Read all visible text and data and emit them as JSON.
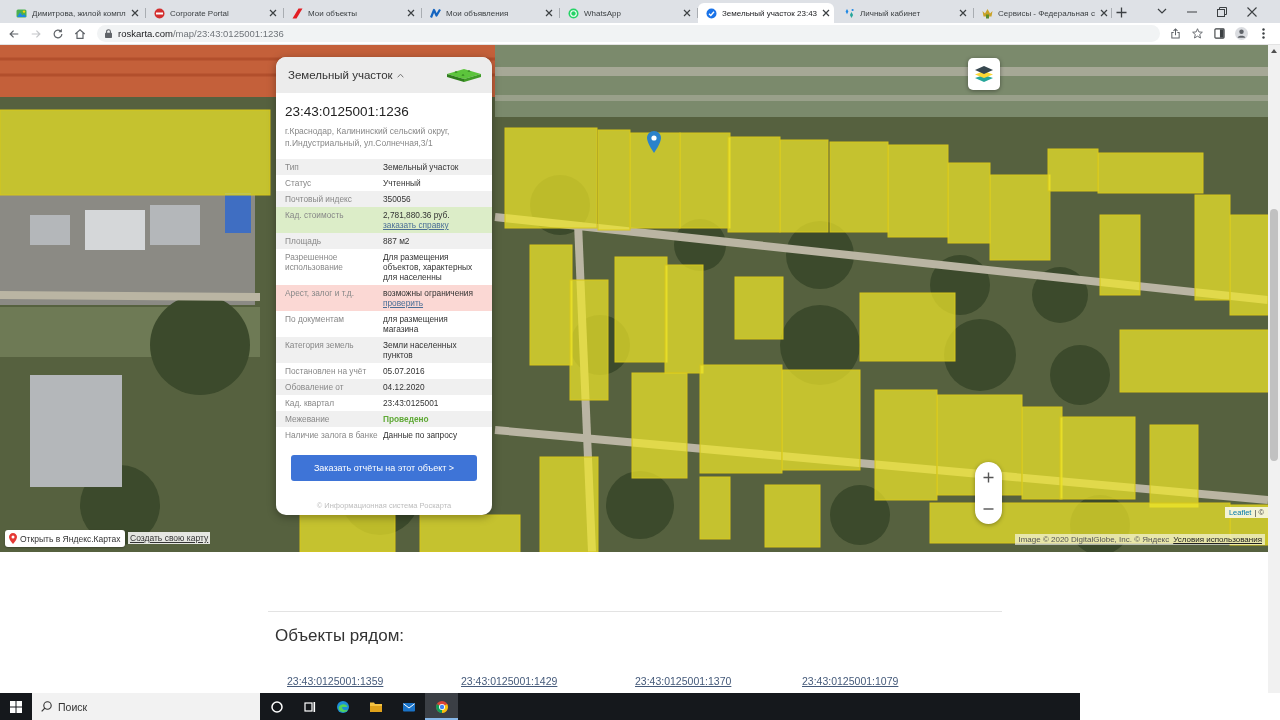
{
  "browser": {
    "tabs": [
      {
        "title": "Димитрова, жилой компл",
        "selected": false
      },
      {
        "title": "Corporate Portal",
        "selected": false
      },
      {
        "title": "Мои объекты",
        "selected": false
      },
      {
        "title": "Мои объявления",
        "selected": false
      },
      {
        "title": "WhatsApp",
        "selected": false
      },
      {
        "title": "Земельный участок 23:43",
        "selected": true
      },
      {
        "title": "Личный кабинет",
        "selected": false
      },
      {
        "title": "Сервисы - Федеральная с",
        "selected": false
      }
    ],
    "nav_buttons": [
      {
        "kind": "back",
        "disabled": false
      },
      {
        "kind": "forward",
        "disabled": true
      },
      {
        "kind": "reload",
        "disabled": false
      },
      {
        "kind": "home",
        "disabled": false
      }
    ],
    "address": {
      "host": "roskarta.com",
      "path": "/map/23:43:0125001:1236"
    }
  },
  "map": {
    "info_panel": {
      "header": "Земельный участок",
      "expanded": true,
      "cadastral_number": "23:43:0125001:1236",
      "address": "г.Краснодар, Калининский сельский округ, п.Индустриальный, ул.Солнечная,3/1",
      "rows": [
        {
          "kind": "plain",
          "label": "Тип",
          "value": "Земельный участок"
        },
        {
          "kind": "plain",
          "label": "Статус",
          "value": "Учтенный"
        },
        {
          "kind": "plain",
          "label": "Почтовый индекс",
          "value": "350056"
        },
        {
          "kind": "highlighted",
          "label": "Кад. стоимость",
          "value": "2,781,880.36 руб.",
          "link": "заказать справку",
          "color": "#dcedc8"
        },
        {
          "kind": "plain",
          "label": "Площадь",
          "value": "887 м2"
        },
        {
          "kind": "plain",
          "label": "Разрешенное использование",
          "value": "Для размещения объектов, характерных для населенны"
        },
        {
          "kind": "highlighted",
          "label": "Арест, залог и т.д.",
          "value": "возможны ограничения",
          "link": "проверить",
          "color": "#fbd8d4"
        },
        {
          "kind": "plain",
          "label": "По документам",
          "value": "для размещения магазина"
        },
        {
          "kind": "plain",
          "label": "Категория земель",
          "value": "Земли населенных пунктов"
        },
        {
          "kind": "plain",
          "label": "Постановлен на учёт",
          "value": "05.07.2016"
        },
        {
          "kind": "plain",
          "label": "Обоваление от",
          "value": "04.12.2020"
        },
        {
          "kind": "plain",
          "label": "Кад. квартал",
          "value": "23:43:0125001"
        },
        {
          "kind": "status",
          "label": "Межевание",
          "value": "Проведено",
          "color": "#5ea935"
        },
        {
          "kind": "plain",
          "label": "Наличие залога в банке",
          "value": "Данные по запросу"
        }
      ],
      "order_button": "Заказать отчёты на этот объект >",
      "footer": "© Информационная система Роскарта"
    },
    "open_in_yandex": "Открыть в Яндекс.Картах",
    "create_map_link": "Создать свою карту",
    "attribution": {
      "link": "Leaflet",
      "text": "| ©"
    },
    "imagery_credit": "Image © 2020 DigitalGlobe, Inc. © Яндекс",
    "terms_link": "Условия использования"
  },
  "nearby": {
    "title": "Объекты рядом:",
    "links": [
      "23:43:0125001:1359",
      "23:43:0125001:1429",
      "23:43:0125001:1370",
      "23:43:0125001:1079"
    ]
  },
  "taskbar": {
    "search": {
      "placeholder": "Поиск"
    },
    "apps": [
      {
        "selected": false
      },
      {
        "selected": false
      },
      {
        "selected": false
      },
      {
        "selected": false
      },
      {
        "selected": false
      },
      {
        "selected": true
      }
    ]
  }
}
